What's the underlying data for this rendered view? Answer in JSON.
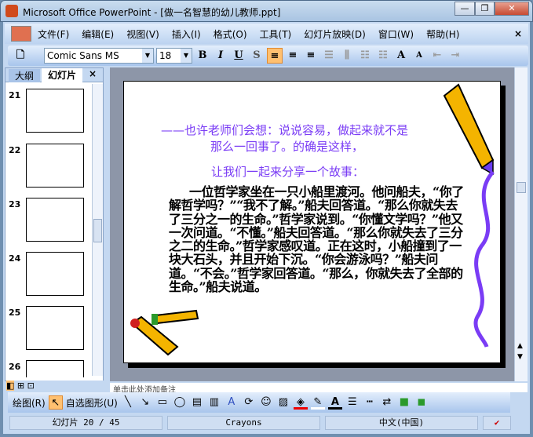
{
  "window": {
    "title": "Microsoft Office PowerPoint - [做一名智慧的幼儿教师.ppt]",
    "minimize": "—",
    "restore": "❐",
    "close": "✕"
  },
  "menu": {
    "items": [
      "文件(F)",
      "编辑(E)",
      "视图(V)",
      "插入(I)",
      "格式(O)",
      "工具(T)",
      "幻灯片放映(D)",
      "窗口(W)",
      "帮助(H)"
    ],
    "close": "×"
  },
  "toolbar": {
    "font": "Comic Sans MS",
    "size": "18",
    "bold": "B",
    "italic": "I",
    "underline": "U",
    "shadow": "S",
    "grow": "A",
    "shrink": "A"
  },
  "pane": {
    "tabs": [
      "大纲",
      "幻灯片"
    ],
    "close": "×",
    "slides": [
      "21",
      "22",
      "23",
      "24",
      "25",
      "26"
    ]
  },
  "slide": {
    "line1": "——也许老师们会想：说说容易，做起来就不是",
    "line2": "那么一回事了。的确是这样，",
    "line3": "让我们一起来分享一个故事：",
    "body": "一位哲学家坐在一只小船里渡河。他问船夫，“你了解哲学吗？”“我不了解。”船夫回答道。“那么你就失去了三分之一的生命。”哲学家说到。“你懂文学吗？”他又一次问道。“不懂。”船夫回答道。“那么你就失去了三分之二的生命。”哲学家感叹道。正在这时，小船撞到了一块大石头，并且开始下沉。“你会游泳吗？”船夫问道。“不会。”哲学家回答道。“那么，你就失去了全部的生命。”船夫说道。"
  },
  "notes": {
    "placeholder": "单击此处添加备注"
  },
  "drawbar": {
    "draw": "绘图(R)",
    "autoshapes": "自选图形(U)"
  },
  "status": {
    "slide": "幻灯片 20 / 45",
    "design": "Crayons",
    "language": "中文(中国)"
  },
  "colors": {
    "accent": "#7a3cf5"
  }
}
